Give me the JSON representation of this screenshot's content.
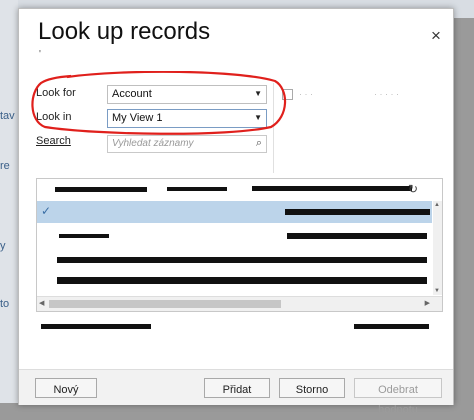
{
  "background": {
    "fragments": [
      "tav",
      "re",
      "y",
      "to"
    ]
  },
  "dialog": {
    "title": "Look up records",
    "close_glyph": "×",
    "look_for": {
      "label": "Look for",
      "value": "Account"
    },
    "look_in": {
      "label": "Look in",
      "value": "My View 1"
    },
    "search": {
      "label": "Search",
      "placeholder": "Vyhledat záznamy"
    },
    "buttons": {
      "new": "Nový",
      "add": "Přidat",
      "cancel": "Storno",
      "remove_value": "Odebrat hodnotu"
    }
  },
  "colors": {
    "annotation": "#e0201c",
    "selected_row": "#bcd4ea"
  }
}
